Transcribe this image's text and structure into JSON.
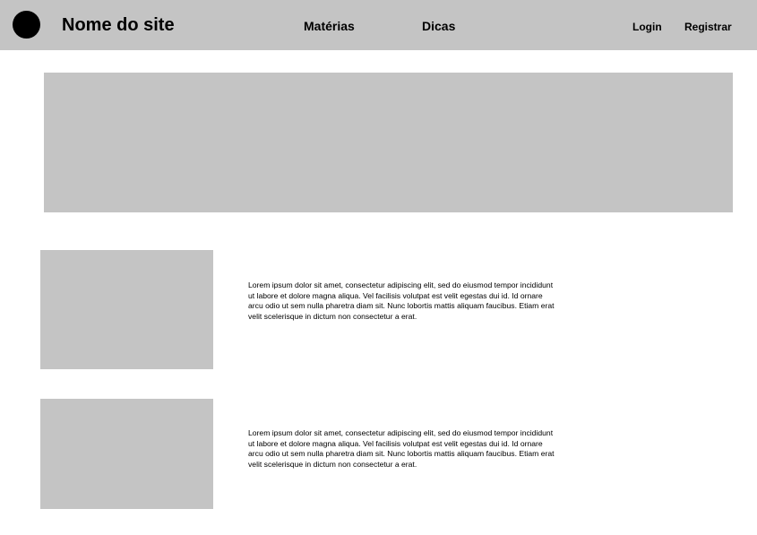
{
  "header": {
    "site_name": "Nome do site",
    "nav": [
      {
        "label": "Matérias"
      },
      {
        "label": "Dicas"
      }
    ],
    "login_label": "Login",
    "register_label": "Registrar"
  },
  "colors": {
    "header_background": "#c4c4c4",
    "placeholder": "#c4c4c4",
    "logo": "#000000"
  },
  "icons": {
    "logo": "circle-logo-icon"
  },
  "articles": [
    {
      "image": "image-placeholder",
      "text": "Lorem ipsum dolor sit amet, consectetur adipiscing elit, sed do eiusmod tempor incididunt ut labore et dolore magna aliqua. Vel facilisis volutpat est velit egestas dui id. Id ornare arcu odio ut sem nulla pharetra diam sit. Nunc lobortis mattis aliquam faucibus. Etiam erat velit scelerisque in dictum non consectetur a erat."
    },
    {
      "image": "image-placeholder",
      "text": "Lorem ipsum dolor sit amet, consectetur adipiscing elit, sed do eiusmod tempor incididunt ut labore et dolore magna aliqua. Vel facilisis volutpat est velit egestas dui id. Id ornare arcu odio ut sem nulla pharetra diam sit. Nunc lobortis mattis aliquam faucibus. Etiam erat velit scelerisque in dictum non consectetur a erat."
    }
  ]
}
